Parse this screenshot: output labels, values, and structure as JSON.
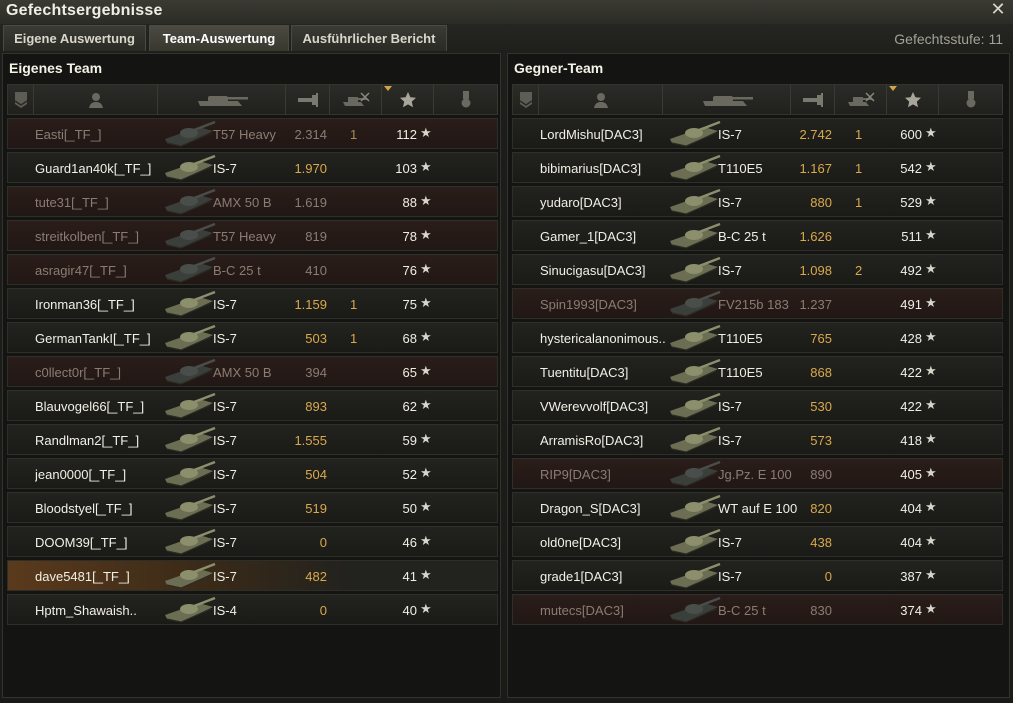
{
  "window": {
    "title": "Gefechtsergebnisse",
    "close_icon": "close-icon"
  },
  "tabs": [
    {
      "label": "Eigene Auswertung",
      "active": false
    },
    {
      "label": "Team-Auswertung",
      "active": true
    },
    {
      "label": "Ausführlicher Bericht",
      "active": false
    }
  ],
  "battle_tier": "Gefechtsstufe: 11",
  "own_team": {
    "title": "Eigenes Team",
    "header_icons": [
      "platoon-icon",
      "player-icon",
      "tank-icon",
      "damage-icon",
      "kills-icon",
      "xp-star-icon",
      "medal-icon"
    ],
    "players": [
      {
        "name": "Easti[_TF_]",
        "tank": "T57 Heavy",
        "damage": "2.314",
        "kills": "1",
        "xp": "112",
        "dead": true,
        "self": false
      },
      {
        "name": "Guard1an40k[_TF_]",
        "tank": "IS-7",
        "damage": "1.970",
        "kills": "",
        "xp": "103",
        "dead": false,
        "self": false
      },
      {
        "name": "tute31[_TF_]",
        "tank": "AMX 50 B",
        "damage": "1.619",
        "kills": "",
        "xp": "88",
        "dead": true,
        "self": false
      },
      {
        "name": "streitkolben[_TF_]",
        "tank": "T57 Heavy",
        "damage": "819",
        "kills": "",
        "xp": "78",
        "dead": true,
        "self": false
      },
      {
        "name": "asragir47[_TF_]",
        "tank": "B-C 25 t",
        "damage": "410",
        "kills": "",
        "xp": "76",
        "dead": true,
        "self": false
      },
      {
        "name": "Ironman36[_TF_]",
        "tank": "IS-7",
        "damage": "1.159",
        "kills": "1",
        "xp": "75",
        "dead": false,
        "self": false
      },
      {
        "name": "GermanTankI[_TF_]",
        "tank": "IS-7",
        "damage": "503",
        "kills": "1",
        "xp": "68",
        "dead": false,
        "self": false
      },
      {
        "name": "c0llect0r[_TF_]",
        "tank": "AMX 50 B",
        "damage": "394",
        "kills": "",
        "xp": "65",
        "dead": true,
        "self": false
      },
      {
        "name": "Blauvogel66[_TF_]",
        "tank": "IS-7",
        "damage": "893",
        "kills": "",
        "xp": "62",
        "dead": false,
        "self": false
      },
      {
        "name": "Randlman2[_TF_]",
        "tank": "IS-7",
        "damage": "1.555",
        "kills": "",
        "xp": "59",
        "dead": false,
        "self": false
      },
      {
        "name": "jean0000[_TF_]",
        "tank": "IS-7",
        "damage": "504",
        "kills": "",
        "xp": "52",
        "dead": false,
        "self": false
      },
      {
        "name": "Bloodstyel[_TF_]",
        "tank": "IS-7",
        "damage": "519",
        "kills": "",
        "xp": "50",
        "dead": false,
        "self": false
      },
      {
        "name": "DOOM39[_TF_]",
        "tank": "IS-7",
        "damage": "0",
        "kills": "",
        "xp": "46",
        "dead": false,
        "self": false
      },
      {
        "name": "dave5481[_TF_]",
        "tank": "IS-7",
        "damage": "482",
        "kills": "",
        "xp": "41",
        "dead": false,
        "self": true
      },
      {
        "name": "Hptm_Shawaish..",
        "tank": "IS-4",
        "damage": "0",
        "kills": "",
        "xp": "40",
        "dead": false,
        "self": false
      }
    ]
  },
  "enemy_team": {
    "title": "Gegner-Team",
    "header_icons": [
      "platoon-icon",
      "player-icon",
      "tank-icon",
      "damage-icon",
      "kills-icon",
      "xp-star-icon",
      "medal-icon"
    ],
    "players": [
      {
        "name": "LordMishu[DAC3]",
        "tank": "IS-7",
        "damage": "2.742",
        "kills": "1",
        "xp": "600",
        "dead": false,
        "self": false
      },
      {
        "name": "bibimarius[DAC3]",
        "tank": "T110E5",
        "damage": "1.167",
        "kills": "1",
        "xp": "542",
        "dead": false,
        "self": false
      },
      {
        "name": "yudaro[DAC3]",
        "tank": "IS-7",
        "damage": "880",
        "kills": "1",
        "xp": "529",
        "dead": false,
        "self": false
      },
      {
        "name": "Gamer_1[DAC3]",
        "tank": "B-C 25 t",
        "damage": "1.626",
        "kills": "",
        "xp": "511",
        "dead": false,
        "self": false
      },
      {
        "name": "Sinucigasu[DAC3]",
        "tank": "IS-7",
        "damage": "1.098",
        "kills": "2",
        "xp": "492",
        "dead": false,
        "self": false
      },
      {
        "name": "Spin1993[DAC3]",
        "tank": "FV215b 183",
        "damage": "1.237",
        "kills": "",
        "xp": "491",
        "dead": true,
        "self": false
      },
      {
        "name": "hystericalanonimous..",
        "tank": "T110E5",
        "damage": "765",
        "kills": "",
        "xp": "428",
        "dead": false,
        "self": false
      },
      {
        "name": "Tuentitu[DAC3]",
        "tank": "T110E5",
        "damage": "868",
        "kills": "",
        "xp": "422",
        "dead": false,
        "self": false
      },
      {
        "name": "VWerevvolf[DAC3]",
        "tank": "IS-7",
        "damage": "530",
        "kills": "",
        "xp": "422",
        "dead": false,
        "self": false
      },
      {
        "name": "ArramisRo[DAC3]",
        "tank": "IS-7",
        "damage": "573",
        "kills": "",
        "xp": "418",
        "dead": false,
        "self": false
      },
      {
        "name": "RIP9[DAC3]",
        "tank": "Jg.Pz. E 100",
        "damage": "890",
        "kills": "",
        "xp": "405",
        "dead": true,
        "self": false
      },
      {
        "name": "Dragon_S[DAC3]",
        "tank": "WT auf E 100",
        "damage": "820",
        "kills": "",
        "xp": "404",
        "dead": false,
        "self": false
      },
      {
        "name": "old0ne[DAC3]",
        "tank": "IS-7",
        "damage": "438",
        "kills": "",
        "xp": "404",
        "dead": false,
        "self": false
      },
      {
        "name": "grade1[DAC3]",
        "tank": "IS-7",
        "damage": "0",
        "kills": "",
        "xp": "387",
        "dead": false,
        "self": false
      },
      {
        "name": "mutecs[DAC3]",
        "tank": "B-C 25 t",
        "damage": "830",
        "kills": "",
        "xp": "374",
        "dead": true,
        "self": false
      }
    ]
  }
}
